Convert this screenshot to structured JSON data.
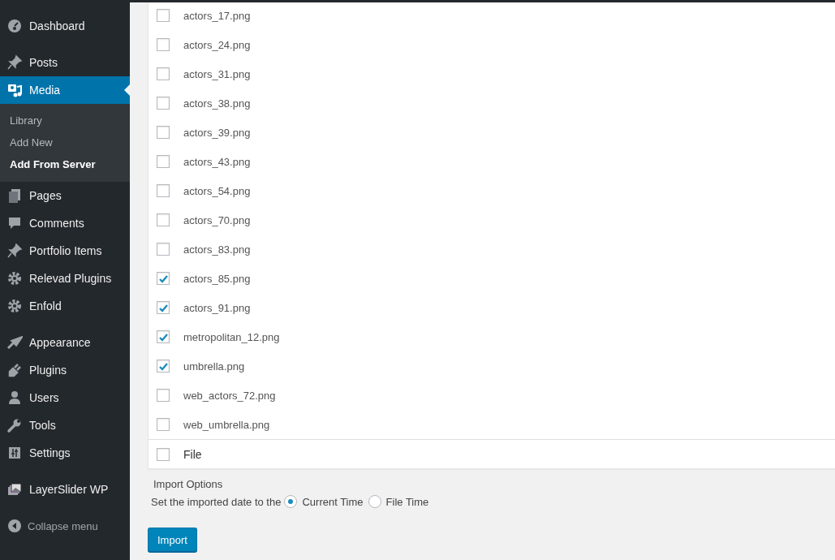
{
  "sidebar": {
    "menu_groups": [
      [
        {
          "label": "Dashboard",
          "selected": false
        }
      ],
      [
        {
          "label": "Posts",
          "selected": false
        },
        {
          "label": "Media",
          "selected": true,
          "children": [
            {
              "label": "Library",
              "selected": false
            },
            {
              "label": "Add New",
              "selected": false
            },
            {
              "label": "Add From Server",
              "selected": true
            }
          ]
        },
        {
          "label": "Pages",
          "selected": false
        },
        {
          "label": "Comments",
          "selected": false
        },
        {
          "label": "Portfolio Items",
          "selected": false
        },
        {
          "label": "Relevad Plugins",
          "selected": false
        },
        {
          "label": "Enfold",
          "selected": false
        }
      ],
      [
        {
          "label": "Appearance",
          "selected": false
        },
        {
          "label": "Plugins",
          "selected": false
        },
        {
          "label": "Users",
          "selected": false
        },
        {
          "label": "Tools",
          "selected": false
        },
        {
          "label": "Settings",
          "selected": false
        }
      ],
      [
        {
          "label": "LayerSlider WP",
          "selected": false
        }
      ]
    ],
    "collapse": "Collapse menu"
  },
  "files": [
    {
      "name": "actors_17.png",
      "checked": false
    },
    {
      "name": "actors_24.png",
      "checked": false
    },
    {
      "name": "actors_31.png",
      "checked": false
    },
    {
      "name": "actors_38.png",
      "checked": false
    },
    {
      "name": "actors_39.png",
      "checked": false
    },
    {
      "name": "actors_43.png",
      "checked": false
    },
    {
      "name": "actors_54.png",
      "checked": false
    },
    {
      "name": "actors_70.png",
      "checked": false
    },
    {
      "name": "actors_83.png",
      "checked": false
    },
    {
      "name": "actors_85.png",
      "checked": true
    },
    {
      "name": "actors_91.png",
      "checked": true
    },
    {
      "name": "metropolitan_12.png",
      "checked": true
    },
    {
      "name": "umbrella.png",
      "checked": true
    },
    {
      "name": "web_actors_72.png",
      "checked": false
    },
    {
      "name": "web_umbrella.png",
      "checked": false
    }
  ],
  "footer": {
    "label": "File",
    "checked": false
  },
  "import_options": {
    "title": "Import Options",
    "prompt": "Set the imported date to the",
    "options": [
      {
        "label": "Current Time",
        "selected": true
      },
      {
        "label": "File Time",
        "selected": false
      }
    ]
  },
  "import_button": "Import"
}
